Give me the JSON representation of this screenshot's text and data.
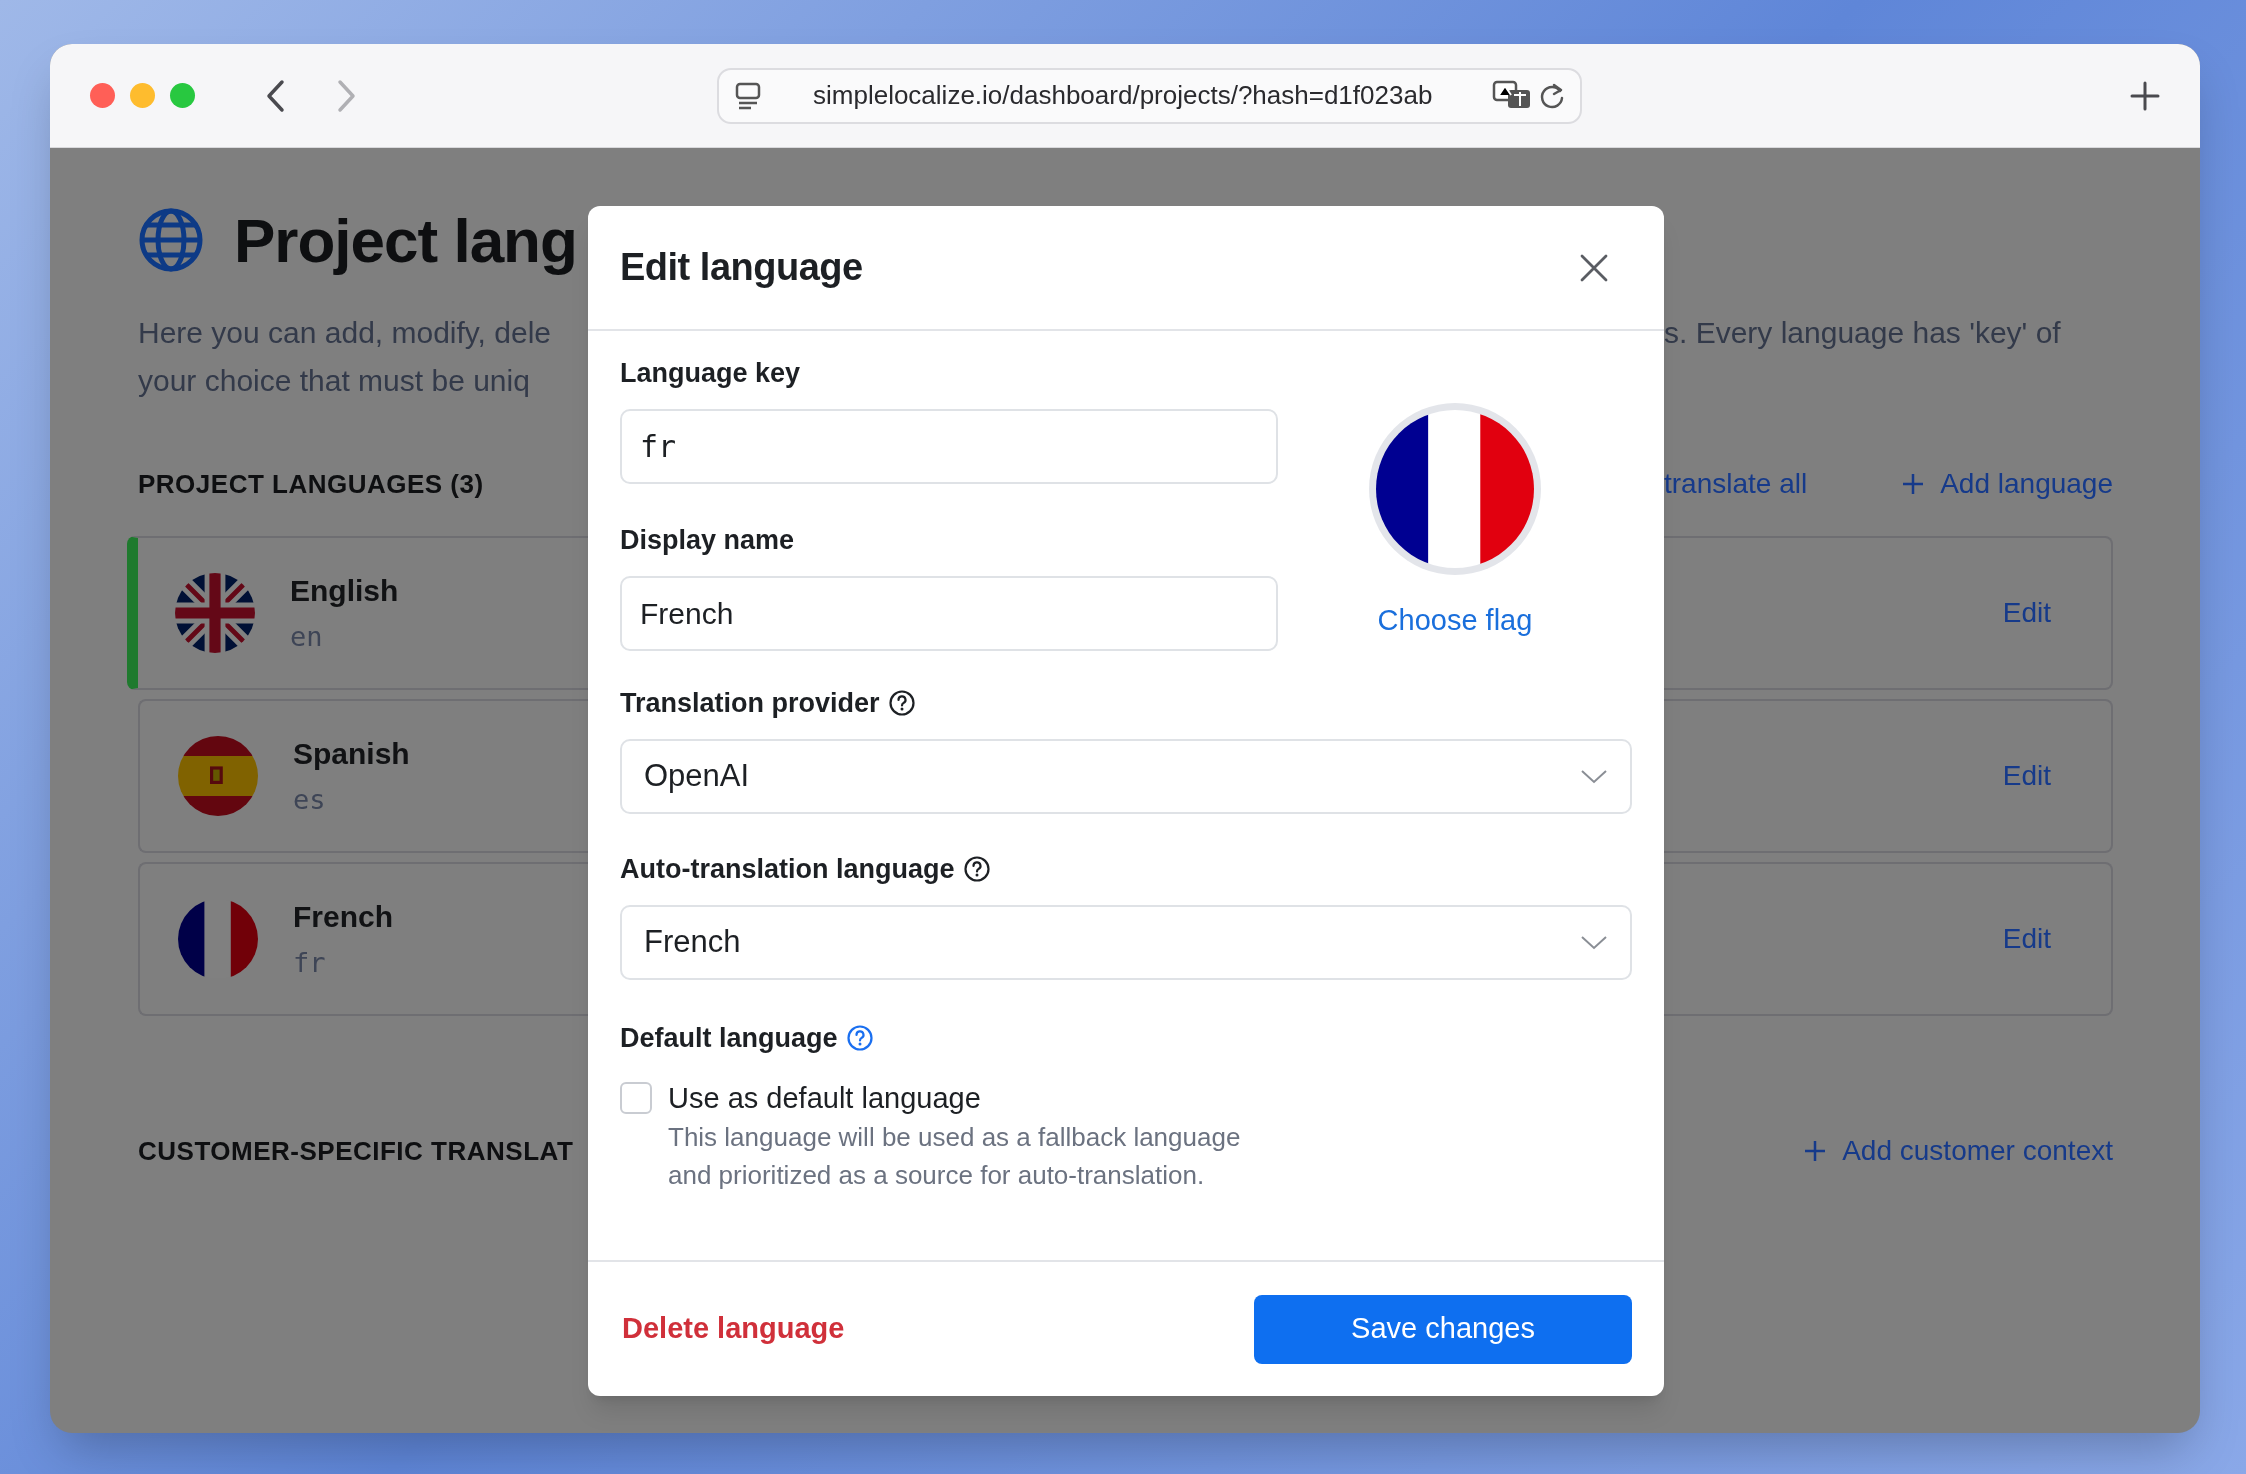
{
  "browser": {
    "url": "simplelocalize.io/dashboard/projects/?hash=d1f023ab",
    "back_enabled": true,
    "forward_enabled": false
  },
  "page": {
    "title": "Project lang",
    "description_left": [
      "Here you can add, modify, dele",
      "your choice that must be uniq"
    ],
    "description_right": "s. Every language has 'key' of",
    "section_heading": "PROJECT LANGUAGES (3)",
    "actions": [
      {
        "kind": "link",
        "label": "translate all"
      },
      {
        "kind": "add",
        "label": "Add language"
      }
    ],
    "languages": [
      {
        "name": "English",
        "key": "en",
        "flag": {
          "kind": "uk"
        },
        "default": true,
        "action": "Edit"
      },
      {
        "name": "Spanish",
        "key": "es",
        "flag": {
          "kind": "es"
        },
        "default": false,
        "action": "Edit"
      },
      {
        "name": "French",
        "key": "fr",
        "flag": {
          "kind": "fr"
        },
        "default": false,
        "action": "Edit"
      }
    ],
    "customer_heading": "CUSTOMER-SPECIFIC TRANSLAT",
    "customer_action": "Add customer context"
  },
  "modal": {
    "title": "Edit language",
    "language_key": {
      "label": "Language key",
      "value": "fr"
    },
    "display_name": {
      "label": "Display name",
      "value": "French"
    },
    "flag": {
      "kind": "fr"
    },
    "choose_flag": "Choose flag",
    "translation_provider": {
      "label": "Translation provider",
      "value": "OpenAI"
    },
    "auto_translation_language": {
      "label": "Auto-translation language",
      "value": "French"
    },
    "default_language": {
      "label": "Default language",
      "checkbox_label": "Use as default language",
      "checked": false,
      "help": [
        "This language will be used as a fallback language",
        "and prioritized as a source for auto-translation."
      ]
    },
    "delete_button": "Delete language",
    "save_button": "Save changes"
  }
}
